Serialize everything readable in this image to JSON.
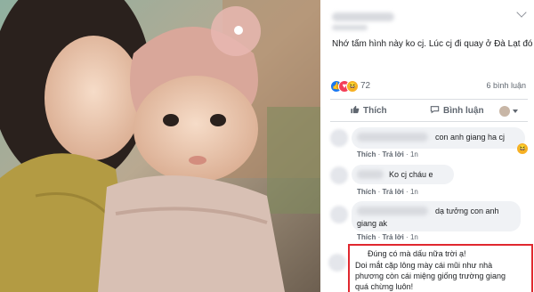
{
  "post": {
    "caption": "Nhớ tấm hình này ko cj. Lúc cj đi quay ở Đà Lạt đó",
    "reaction_count": "72",
    "comment_count": "6 bình luận",
    "like_label": "Thích",
    "comment_label": "Bình luận"
  },
  "comments": [
    {
      "text": "con anh giang ha cj",
      "like": "Thích",
      "reply": "Trả lời",
      "time": "1n"
    },
    {
      "text": "Ko cj cháu e",
      "like": "Thích",
      "reply": "Trả lời",
      "time": "1n"
    },
    {
      "line1": "dạ tưởng con anh",
      "line2": "giang ak",
      "like": "Thích",
      "reply": "Trả lời",
      "time": "1n"
    }
  ],
  "highlight": {
    "line1": "Đúng có mà dấu nữa trời ạ!",
    "line2": "Doi mắt cặp lông mày cái mũi như nhà",
    "line3": "phương còn cái miệng giống trường giang",
    "line4": "quá chừng luôn!"
  },
  "icons": [
    "chevron-down-icon",
    "like-reaction-icon",
    "love-reaction-icon",
    "haha-reaction-icon",
    "thumbs-up-icon",
    "comment-icon"
  ],
  "colors": {
    "link": "#1877f2",
    "highlight_border": "#e0282f",
    "bubble": "#f0f2f5"
  }
}
